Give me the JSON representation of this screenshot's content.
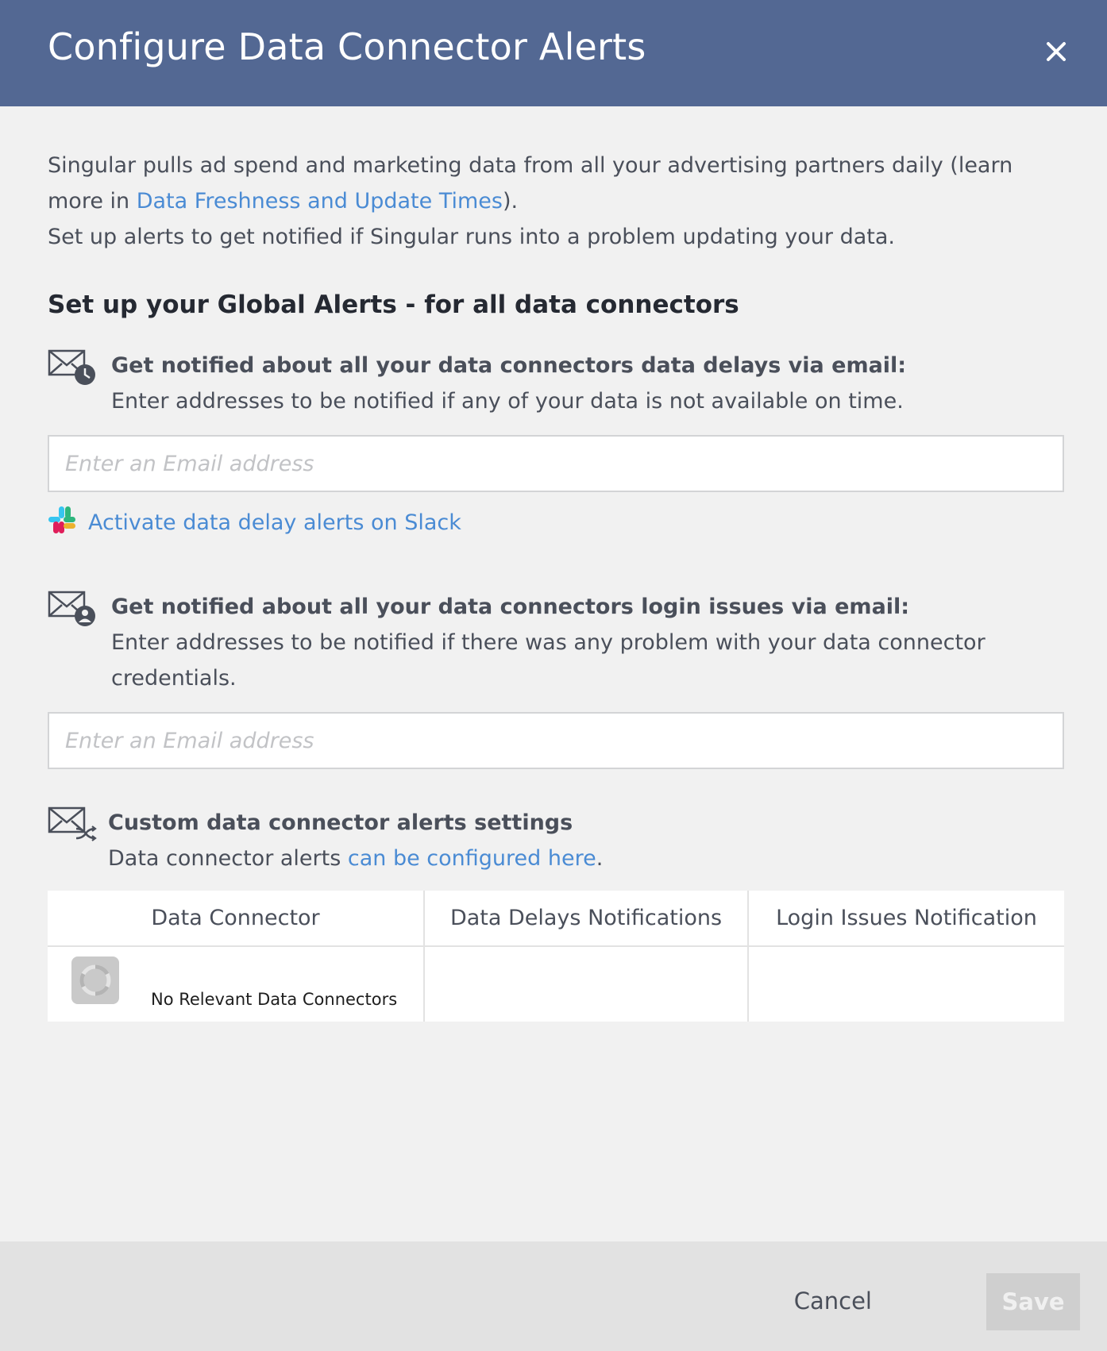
{
  "header": {
    "title": "Configure Data Connector Alerts",
    "close_icon": "close-icon"
  },
  "intro": {
    "line1_prefix": "Singular pulls ad spend and marketing data from all your advertising partners daily (learn more in ",
    "line1_link": "Data Freshness and Update Times",
    "line1_suffix": ").",
    "line2": "Set up alerts to get notified if Singular runs into a problem updating your data."
  },
  "global_title": "Set up your Global Alerts - for all data connectors",
  "delays": {
    "icon": "email-clock-icon",
    "heading": "Get notified about all your data connectors data delays via email:",
    "description": "Enter addresses to be notified if any of your data is not available on time.",
    "placeholder": "Enter an Email address",
    "slack_link": "Activate data delay alerts on Slack"
  },
  "login": {
    "icon": "email-user-icon",
    "heading": "Get notified about all your data connectors login issues via email:",
    "description": "Enter addresses to be notified if there was any problem with your data connector credentials.",
    "placeholder": "Enter an Email address"
  },
  "custom": {
    "icon": "email-shuffle-icon",
    "heading": "Custom data connector alerts settings",
    "desc_prefix": "Data connector alerts ",
    "desc_link": "can be configured here",
    "desc_suffix": "."
  },
  "table": {
    "headers": [
      "Data Connector",
      "Data Delays Notifications",
      "Login Issues Notification"
    ],
    "empty_text": "No Relevant Data Connectors"
  },
  "footer": {
    "cancel": "Cancel",
    "save": "Save"
  },
  "colors": {
    "header_bg": "#536893",
    "link": "#4a8bd4",
    "body_bg": "#f1f1f1",
    "footer_bg": "#e2e2e2"
  }
}
